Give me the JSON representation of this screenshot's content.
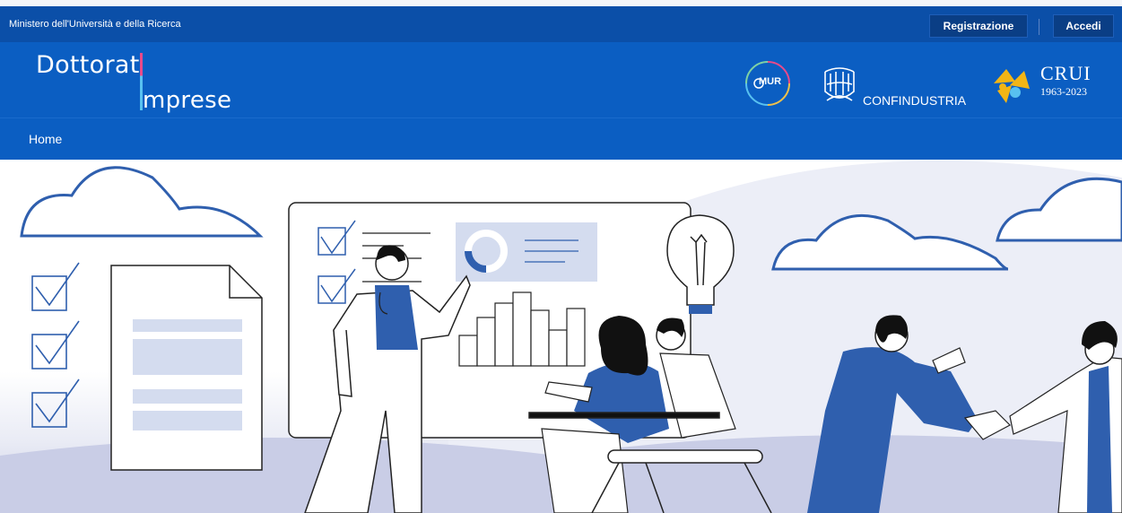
{
  "topbar": {
    "ministry": "Ministero dell'Università e della Ricerca",
    "register_label": "Registrazione",
    "login_label": "Accedi"
  },
  "brand": {
    "line1": "Dottorat",
    "line2": "mprese",
    "accent_colors": [
      "#e84a8a",
      "#58c1f0"
    ]
  },
  "partners": {
    "mur": "MUR",
    "confindustria": "CONFINDUSTRIA",
    "crui_name": "CRUI",
    "crui_years": "1963-2023"
  },
  "nav": {
    "home": "Home"
  },
  "colors": {
    "topbar": "#0b4fa8",
    "brandbar": "#0b5ec2",
    "illustration_blue": "#2f5fae",
    "illustration_light": "#d4dcef"
  }
}
